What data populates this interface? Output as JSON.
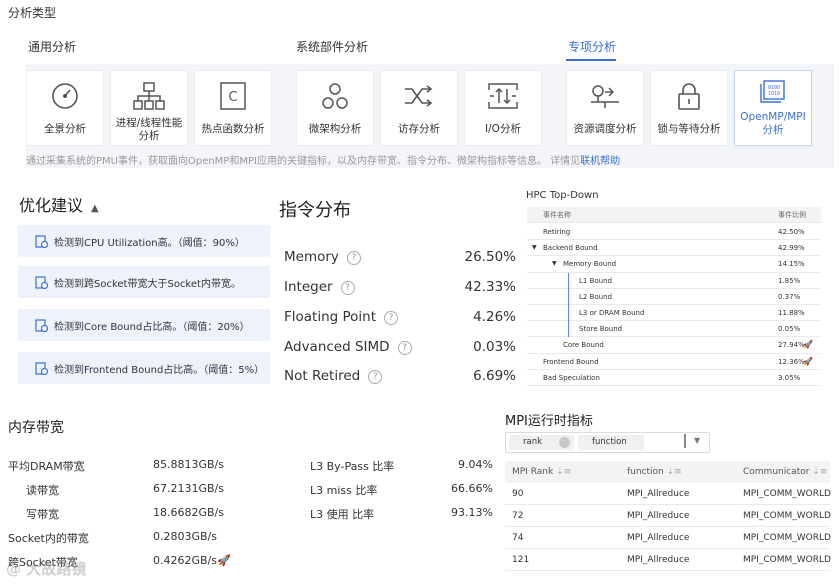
{
  "section_title": "分析类型",
  "categories": [
    "通用分析",
    "系统部件分析",
    "专项分析"
  ],
  "cards": [
    {
      "label": "全景分析",
      "icon": "gauge-icon"
    },
    {
      "label": "进程/线程性能分析",
      "icon": "hierarchy-icon"
    },
    {
      "label": "热点函数分析",
      "icon": "code-c-icon"
    },
    {
      "label": "微架构分析",
      "icon": "nodes-icon"
    },
    {
      "label": "访存分析",
      "icon": "shuffle-icon"
    },
    {
      "label": "I/O分析",
      "icon": "io-icon"
    },
    {
      "label": "资源调度分析",
      "icon": "scheduling-icon"
    },
    {
      "label": "锁与等待分析",
      "icon": "lock-icon"
    },
    {
      "label": "OpenMP/MPI分析",
      "icon": "openmp-mpi-icon"
    }
  ],
  "description": "通过采集系统的PMU事件，获取面向OpenMP和MPI应用的关键指标，以及内存带宽、指令分布、微架构指标等信息。 详情见",
  "help_link": "联机帮助",
  "optimization": {
    "title": "优化建议",
    "items": [
      "检测到CPU Utilization高。（阈值：90%）",
      "检测到跨Socket带宽大于Socket内带宽。",
      "检测到Core Bound占比高。（阈值：20%）",
      "检测到Frontend Bound占比高。（阈值：5%）"
    ]
  },
  "instructions": {
    "title": "指令分布",
    "rows": [
      {
        "name": "Memory",
        "value": "26.50%"
      },
      {
        "name": "Integer",
        "value": "42.33%"
      },
      {
        "name": "Floating Point",
        "value": "4.26%"
      },
      {
        "name": "Advanced SIMD",
        "value": "0.03%"
      },
      {
        "name": "Not Retired",
        "value": "6.69%"
      }
    ]
  },
  "topdown": {
    "title": "HPC Top-Down",
    "col_name": "事件名称",
    "col_ratio": "事件比例",
    "rows": [
      {
        "name": "Retiring",
        "value": "42.50%",
        "level": 0,
        "expand": false,
        "flag": false
      },
      {
        "name": "Backend Bound",
        "value": "42.99%",
        "level": 0,
        "expand": true,
        "flag": false
      },
      {
        "name": "Memory Bound",
        "value": "14.15%",
        "level": 1,
        "expand": true,
        "flag": false
      },
      {
        "name": "L1 Bound",
        "value": "1.85%",
        "level": 2,
        "expand": false,
        "flag": false
      },
      {
        "name": "L2 Bound",
        "value": "0.37%",
        "level": 2,
        "expand": false,
        "flag": false
      },
      {
        "name": "L3 or DRAM Bound",
        "value": "11.88%",
        "level": 2,
        "expand": false,
        "flag": false
      },
      {
        "name": "Store Bound",
        "value": "0.05%",
        "level": 2,
        "expand": false,
        "flag": false
      },
      {
        "name": "Core Bound",
        "value": "27.94%",
        "level": 1,
        "expand": false,
        "flag": true
      },
      {
        "name": "Frontend Bound",
        "value": "12.36%",
        "level": 0,
        "expand": false,
        "flag": true
      },
      {
        "name": "Bad Speculation",
        "value": "3.05%",
        "level": 0,
        "expand": false,
        "flag": false
      }
    ]
  },
  "memory": {
    "title": "内存带宽",
    "left": [
      {
        "name": "平均DRAM带宽",
        "value": "85.8813GB/s",
        "indent": false,
        "flag": false
      },
      {
        "name": "读带宽",
        "value": "67.2131GB/s",
        "indent": true,
        "flag": false
      },
      {
        "name": "写带宽",
        "value": "18.6682GB/s",
        "indent": true,
        "flag": false
      },
      {
        "name": "Socket内的带宽",
        "value": "0.2803GB/s",
        "indent": false,
        "flag": false
      },
      {
        "name": "跨Socket带宽",
        "value": "0.4262GB/s",
        "indent": false,
        "flag": true
      }
    ],
    "right": [
      {
        "name": "L3 By-Pass 比率",
        "value": "9.04%"
      },
      {
        "name": "L3 miss 比率",
        "value": "66.66%"
      },
      {
        "name": "L3 使用 比率",
        "value": "93.13%"
      }
    ]
  },
  "mpi": {
    "title": "MPI运行时指标",
    "filter_tags": [
      "rank",
      "function"
    ],
    "columns": [
      "MPI Rank",
      "function",
      "Communicator"
    ],
    "rows": [
      [
        "90",
        "MPI_Allreduce",
        "MPI_COMM_WORLD"
      ],
      [
        "72",
        "MPI_Allreduce",
        "MPI_COMM_WORLD"
      ],
      [
        "74",
        "MPI_Allreduce",
        "MPI_COMM_WORLD"
      ],
      [
        "121",
        "MPI_Allreduce",
        "MPI_COMM_WORLD"
      ]
    ]
  },
  "watermark": "@ 大故路镜",
  "colors": {
    "accent": "#3a6fd8",
    "flag": "#e8542a",
    "card_bg": "#f3f5f8",
    "suggestion_bg": "#eef3fb"
  }
}
